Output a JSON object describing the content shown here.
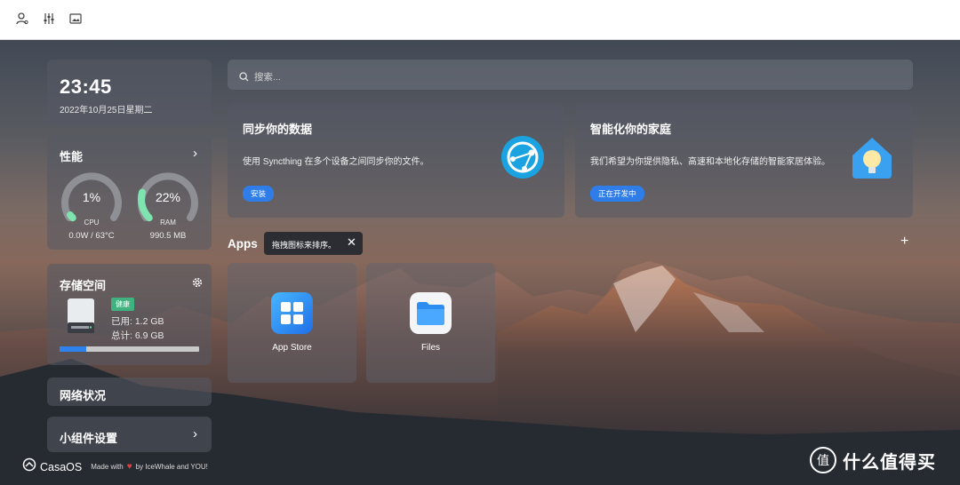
{
  "topbar": {
    "icons": [
      "user-settings-icon",
      "sliders-icon",
      "wallpaper-icon"
    ]
  },
  "clock": {
    "time": "23:45",
    "date": "2022年10月25日星期二"
  },
  "performance": {
    "title": "性能",
    "cpu": {
      "percent": 1,
      "percent_label": "1%",
      "name": "CPU",
      "sub": "0.0W / 63°C"
    },
    "ram": {
      "percent": 22,
      "percent_label": "22%",
      "name": "RAM",
      "sub": "990.5 MB"
    }
  },
  "storage": {
    "title": "存储空间",
    "status": "健康",
    "used": "已用: 1.2 GB",
    "total": "总计: 6.9 GB",
    "usage_fraction": 0.19
  },
  "network": {
    "title": "网络状况"
  },
  "widget_settings": {
    "title": "小组件设置"
  },
  "footer": {
    "brand": "CasaOS",
    "made_with": "Made with",
    "by": "by IceWhale and YOU!"
  },
  "search": {
    "placeholder": "搜索..."
  },
  "promos": [
    {
      "title": "同步你的数据",
      "desc": "使用 Syncthing 在多个设备之间同步你的文件。",
      "button": "安装"
    },
    {
      "title": "智能化你的家庭",
      "desc": "我们希望为你提供隐私、高速和本地化存储的智能家居体验。",
      "button": "正在开发中"
    }
  ],
  "apps": {
    "title": "Apps",
    "tooltip": "拖拽图标来排序。",
    "items": [
      {
        "label": "App Store"
      },
      {
        "label": "Files"
      }
    ]
  },
  "watermark": {
    "text": "什么值得买",
    "logo": "值"
  },
  "colors": {
    "accent": "#2f7de8",
    "healthy": "#3fb27f",
    "gauge": "#7fe3b0"
  }
}
